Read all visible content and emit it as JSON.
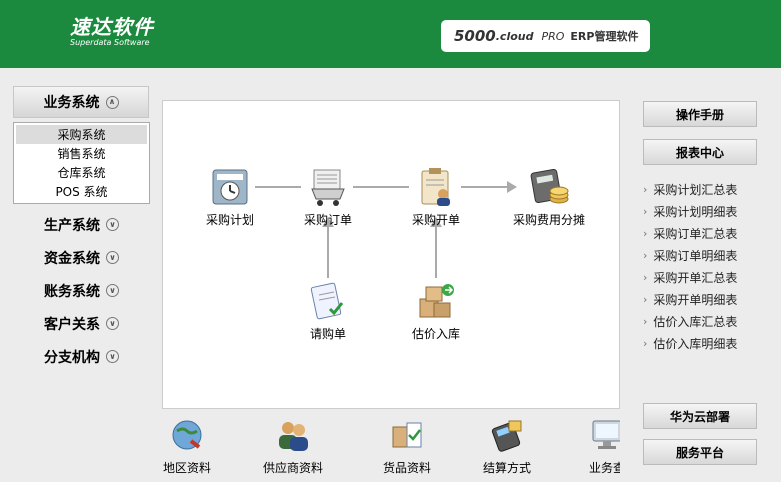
{
  "header": {
    "logo_main": "速达软件",
    "logo_sub": "Superdata Software",
    "product_number": "5000",
    "product_cloud": ".cloud",
    "product_pro": "PRO",
    "product_erp": "ERP管理软件"
  },
  "nav": {
    "top_label": "业务系统",
    "submenu": [
      "采购系统",
      "销售系统",
      "仓库系统",
      "POS 系统"
    ],
    "items": [
      "生产系统",
      "资金系统",
      "账务系统",
      "客户关系",
      "分支机构"
    ]
  },
  "flow": {
    "plan": "采购计划",
    "order": "采购订单",
    "invoice": "采购开单",
    "cost": "采购费用分摊",
    "request": "请购单",
    "estimate": "估价入库"
  },
  "right": {
    "manual": "操作手册",
    "reports": "报表中心",
    "report_items": [
      "采购计划汇总表",
      "采购计划明细表",
      "采购订单汇总表",
      "采购订单明细表",
      "采购开单汇总表",
      "采购开单明细表",
      "估价入库汇总表",
      "估价入库明细表"
    ],
    "huawei": "华为云部署",
    "service": "服务平台"
  },
  "bottom": [
    "地区资料",
    "供应商资料",
    "货品资料",
    "结算方式",
    "业务查"
  ],
  "icons": {
    "plan": "calendar-clock-icon",
    "order": "cart-icon",
    "invoice": "clipboard-user-icon",
    "cost": "calculator-coins-icon",
    "request": "clipboard-check-icon",
    "estimate": "boxes-icon"
  },
  "colors": {
    "header": "#1b8a3e"
  }
}
